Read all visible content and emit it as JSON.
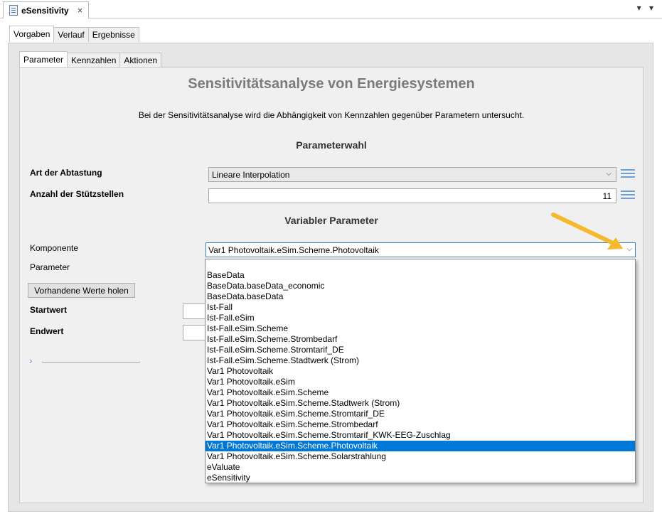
{
  "editor_tab": {
    "title": "eSensitivity",
    "close": "×",
    "menu": "▾ ▾"
  },
  "outer_tabs": [
    "Vorgaben",
    "Verlauf",
    "Ergebnisse"
  ],
  "inner_tabs": [
    "Parameter",
    "Kennzahlen",
    "Aktionen"
  ],
  "page": {
    "title": "Sensitivitätsanalyse von Energiesystemen",
    "description": "Bei der Sensitivitätsanalyse wird die Abhängigkeit von Kennzahlen gegenüber Parametern untersucht.",
    "section_parameterwahl": "Parameterwahl",
    "section_variabler": "Variabler Parameter"
  },
  "fields": {
    "art_label": "Art der Abtastung",
    "art_value": "Lineare Interpolation",
    "anzahl_label": "Anzahl der Stützstellen",
    "anzahl_value": "11",
    "komponente_label": "Komponente",
    "komponente_value": "Var1 Photovoltaik.eSim.Scheme.Photovoltaik",
    "parameter_label": "Parameter",
    "button_label": "Vorhandene Werte holen",
    "startwert_label": "Startwert",
    "endwert_label": "Endwert"
  },
  "dropdown": {
    "items": [
      "BaseData",
      "BaseData.baseData_economic",
      "BaseData.baseData",
      "Ist-Fall",
      "Ist-Fall.eSim",
      "Ist-Fall.eSim.Scheme",
      "Ist-Fall.eSim.Scheme.Strombedarf",
      "Ist-Fall.eSim.Scheme.Stromtarif_DE",
      "Ist-Fall.eSim.Scheme.Stadtwerk (Strom)",
      "Var1 Photovoltaik",
      "Var1 Photovoltaik.eSim",
      "Var1 Photovoltaik.eSim.Scheme",
      "Var1 Photovoltaik.eSim.Scheme.Stadtwerk (Strom)",
      "Var1 Photovoltaik.eSim.Scheme.Stromtarif_DE",
      "Var1 Photovoltaik.eSim.Scheme.Strombedarf",
      "Var1 Photovoltaik.eSim.Scheme.Stromtarif_KWK-EEG-Zuschlag",
      "Var1 Photovoltaik.eSim.Scheme.Photovoltaik",
      "Var1 Photovoltaik.eSim.Scheme.Solarstrahlung",
      "eValuate",
      "eSensitivity"
    ],
    "selected_index": 16
  },
  "colors": {
    "accent": "#0078d7",
    "annotation_arrow": "#f5b82e",
    "list_icon": "#6ea1cf"
  },
  "icons": {
    "doc": "document-icon",
    "chevron": "⌵",
    "expander": "›"
  }
}
